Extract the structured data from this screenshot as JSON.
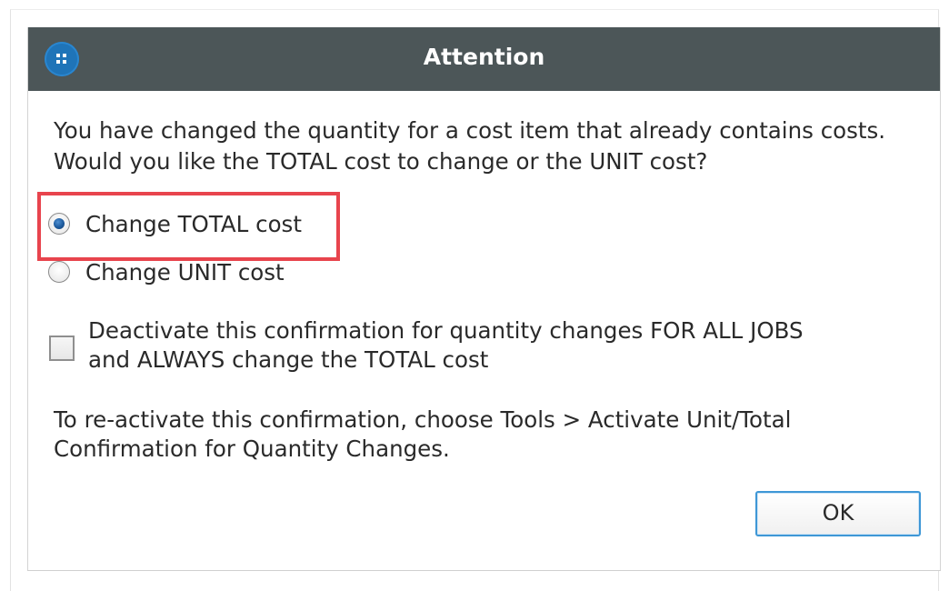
{
  "dialog": {
    "title": "Attention",
    "app_icon": "app-grid-icon",
    "message_line1": "You have changed the quantity for a cost item that already contains costs.",
    "message_line2": "Would you like the TOTAL cost to change or the UNIT cost?",
    "options": [
      {
        "label": "Change TOTAL cost",
        "selected": true
      },
      {
        "label": "Change UNIT cost",
        "selected": false
      }
    ],
    "checkbox": {
      "label_line1": "Deactivate this confirmation for quantity changes FOR ALL JOBS",
      "label_line2": "and ALWAYS change the TOTAL cost",
      "checked": false
    },
    "note_line1": "To re-activate this confirmation, choose Tools > Activate Unit/Total",
    "note_line2": "Confirmation for Quantity Changes.",
    "ok_label": "OK"
  },
  "colors": {
    "titlebar": "#4c5658",
    "highlight": "#e8444d",
    "ok_border": "#3e97d6"
  }
}
